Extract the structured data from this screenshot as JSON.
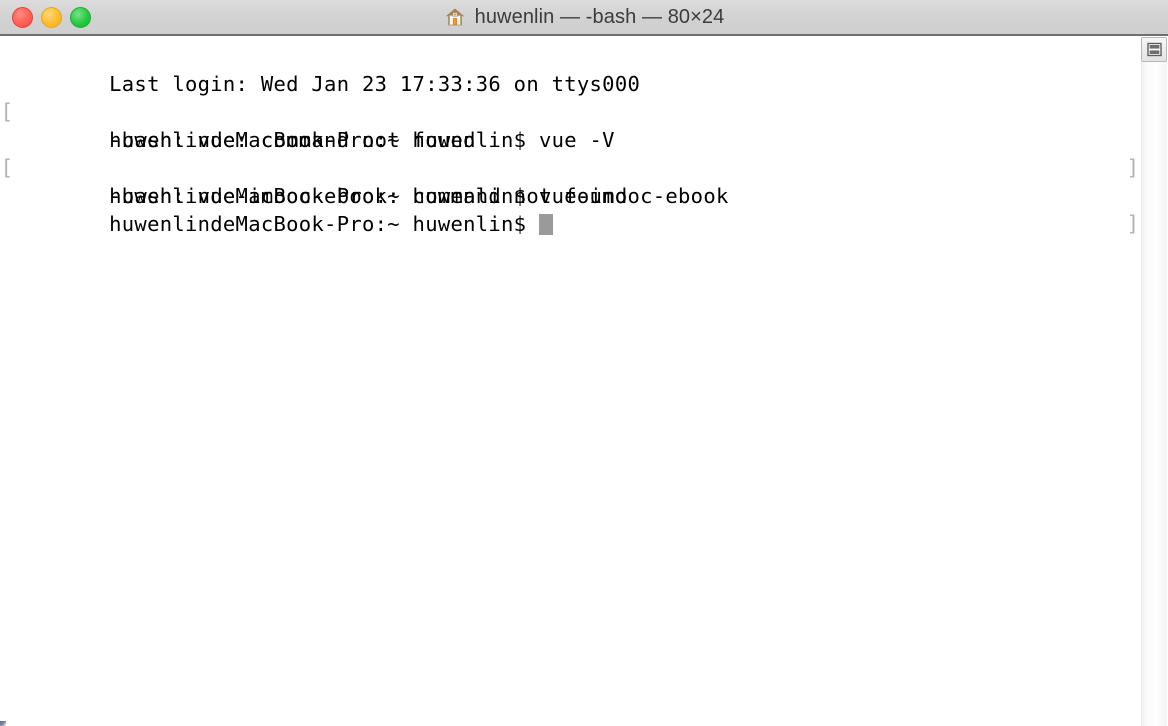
{
  "window": {
    "title": "huwenlin — -bash — 80×24",
    "proxy_icon": "home-folder-icon",
    "traffic_lights": {
      "close_label": "Close",
      "minimize_label": "Minimize",
      "zoom_label": "Zoom",
      "close_color": "#ff5f57",
      "minimize_color": "#febc2e",
      "zoom_color": "#28c840"
    },
    "titlebar_color": "#d4d4d4",
    "background_color": "#ffffff",
    "text_color": "#000000"
  },
  "terminal": {
    "columns": 80,
    "rows": 24,
    "shell": "-bash",
    "user": "huwenlin",
    "host": "huwenlindeMacBook-Pro",
    "cursor": {
      "glyph": "block-cursor",
      "color": "#9a9a9a"
    },
    "wrap_marker_open": "[",
    "wrap_marker_close": "]",
    "lines": [
      {
        "text": "Last login: Wed Jan 23 17:33:36 on ttys000",
        "wrapped": false
      },
      {
        "text": "huwenlindeMacBook-Pro:~ huwenlin$ vue -V",
        "wrapped": true
      },
      {
        "text": "-bash: vue: command not found",
        "wrapped": false
      },
      {
        "text": "huwenlindeMacBook-Pro:~ huwenlin$ vue-imooc-ebook",
        "wrapped": true
      },
      {
        "text": "-bash: vue-imooc-ebook: command not found",
        "wrapped": false
      },
      {
        "text": "huwenlindeMacBook-Pro:~ huwenlin$ ",
        "wrapped": false,
        "cursor": true
      }
    ]
  },
  "scrollbar": {
    "pane_button_label": "split-pane-toggle",
    "track_color": "#f6f6f6"
  }
}
